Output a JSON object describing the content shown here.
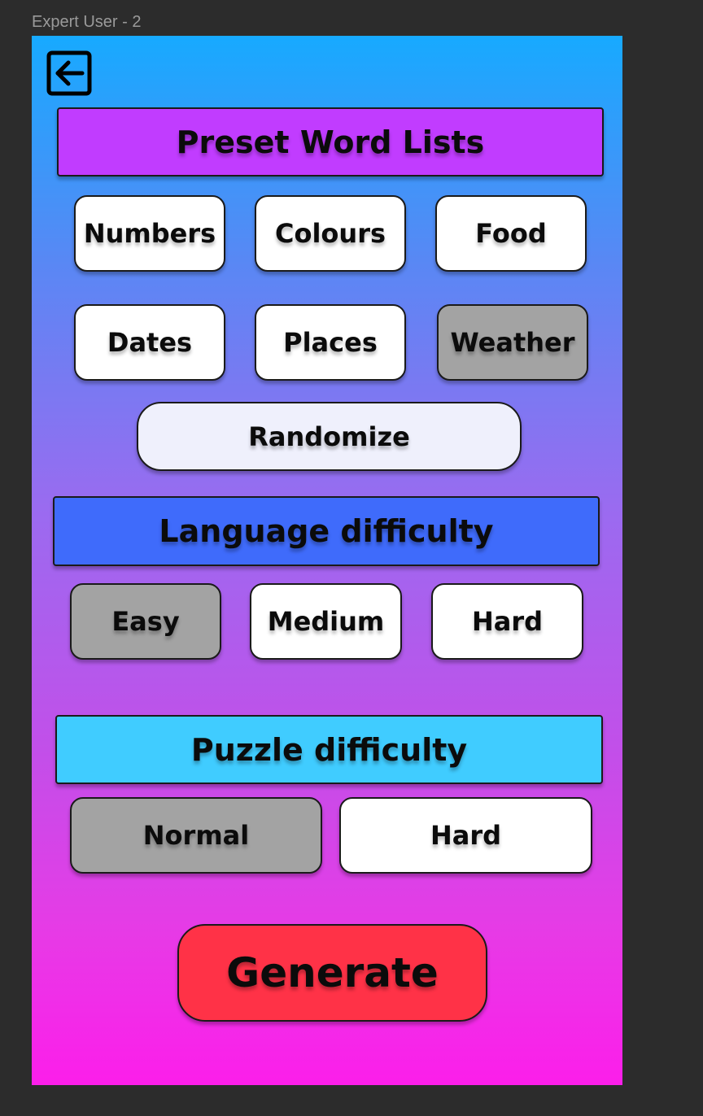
{
  "canvas": {
    "frame_label": "Expert User - 2"
  },
  "screen": {
    "back_icon": "arrow-left-box-icon",
    "preset": {
      "title": "Preset Word Lists",
      "title_color": "#c13cff",
      "lists": [
        {
          "label": "Numbers",
          "selected": false
        },
        {
          "label": "Colours",
          "selected": false
        },
        {
          "label": "Food",
          "selected": false
        },
        {
          "label": "Dates",
          "selected": false
        },
        {
          "label": "Places",
          "selected": false
        },
        {
          "label": "Weather",
          "selected": true
        }
      ],
      "randomize_label": "Randomize"
    },
    "language": {
      "title": "Language difficulty",
      "title_color": "#3f6bfb",
      "options": [
        {
          "label": "Easy",
          "selected": true
        },
        {
          "label": "Medium",
          "selected": false
        },
        {
          "label": "Hard",
          "selected": false
        }
      ]
    },
    "puzzle": {
      "title": "Puzzle difficulty",
      "title_color": "#40ccff",
      "options": [
        {
          "label": "Normal",
          "selected": true
        },
        {
          "label": "Hard",
          "selected": false
        }
      ]
    },
    "generate_label": "Generate",
    "colors": {
      "selected_chip": "#a3a3a3",
      "unselected_chip": "#ffffff",
      "generate_button": "#ff3247"
    }
  }
}
